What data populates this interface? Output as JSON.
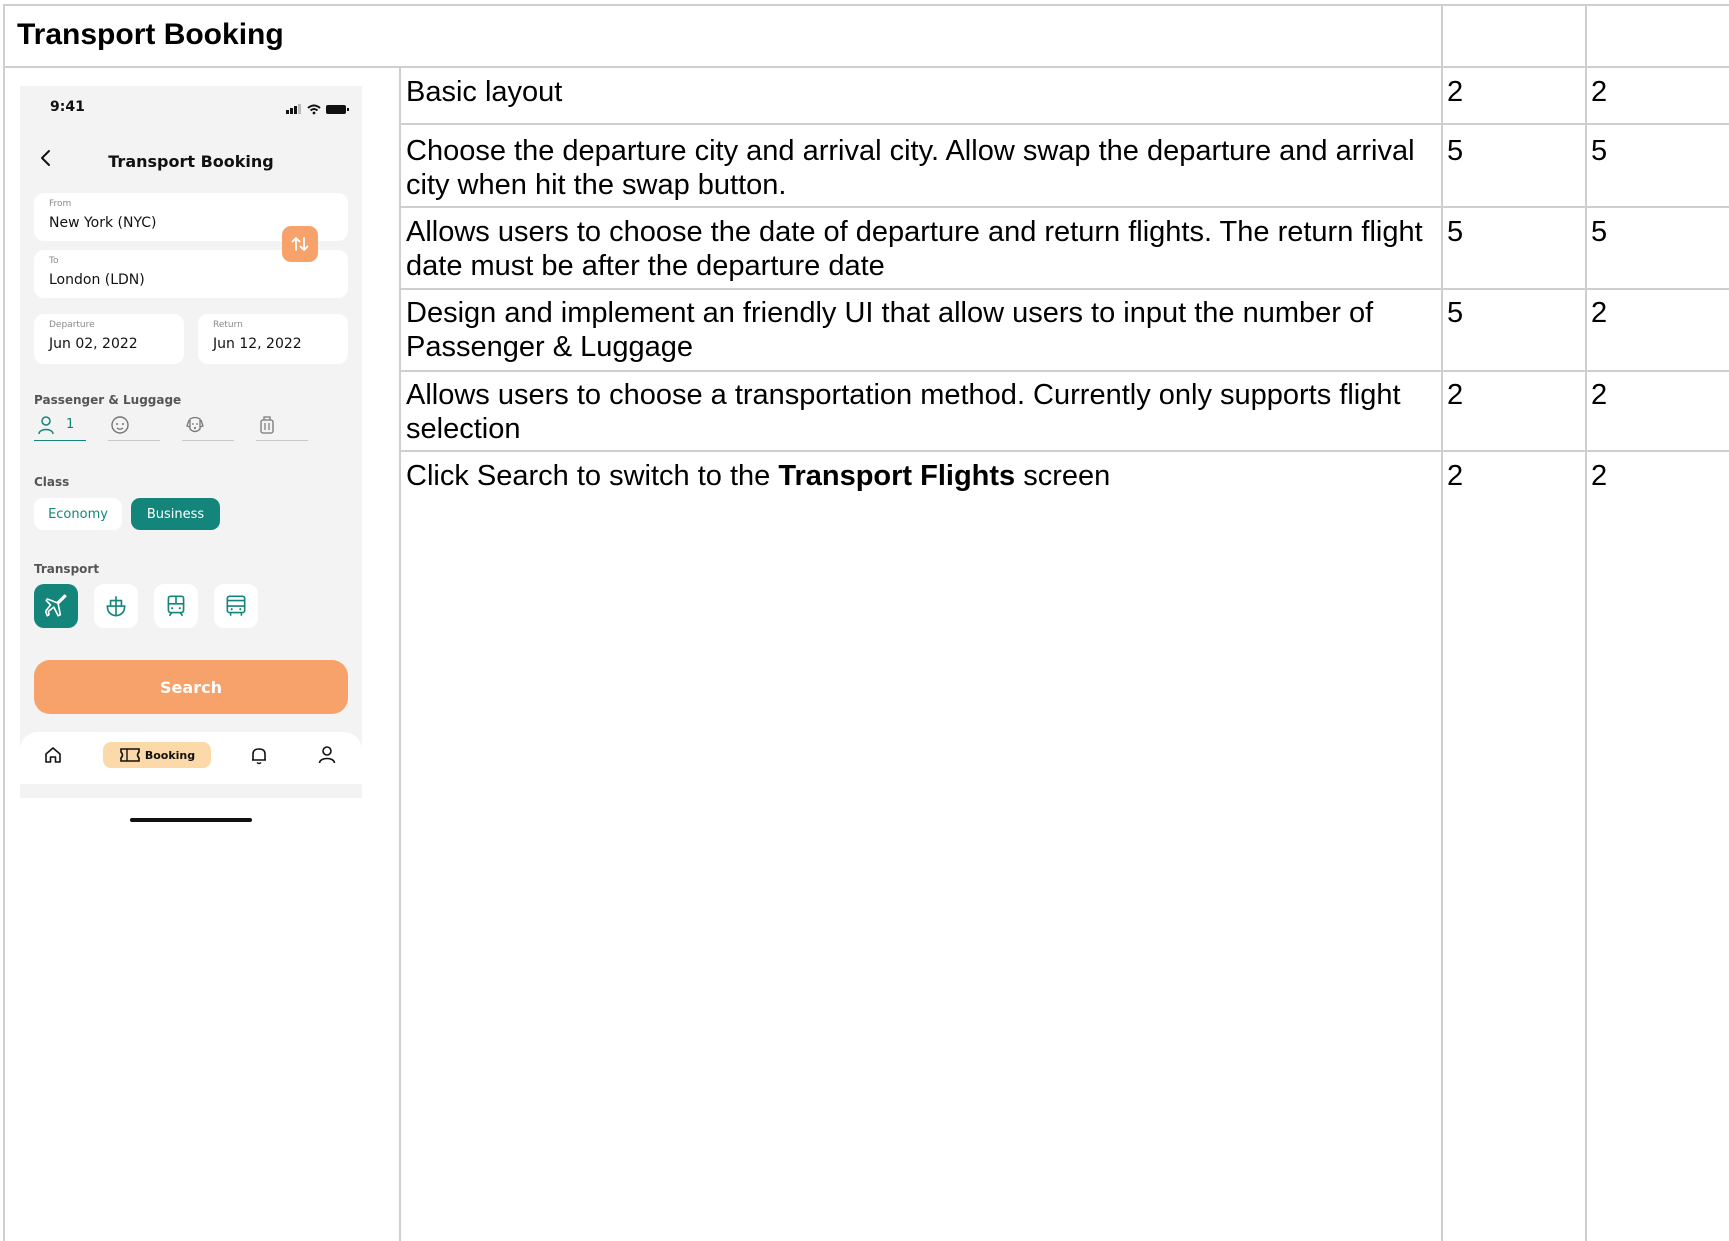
{
  "sheet": {
    "title": "Transport Booking",
    "rows": [
      {
        "requirement": "Basic layout",
        "score_a": "2",
        "score_b": "2"
      },
      {
        "requirement": "Choose the departure city and arrival city. Allow swap the departure and arrival city when hit the swap button.",
        "score_a": "5",
        "score_b": "5"
      },
      {
        "requirement": "Allows users to choose the date of departure and return flights. The return flight date must be after the departure date",
        "score_a": "5",
        "score_b": "5"
      },
      {
        "requirement": "Design and implement an friendly UI that allow users to input the number of Passenger & Luggage",
        "score_a": "5",
        "score_b": "2"
      },
      {
        "requirement": "Allows users to choose a transportation method. Currently only supports flight selection",
        "score_a": "2",
        "score_b": "2"
      },
      {
        "requirement_prefix": "Click Search to switch to the ",
        "requirement_bold": "Transport Flights",
        "requirement_suffix": " screen",
        "score_a": "2",
        "score_b": "2"
      }
    ]
  },
  "phone": {
    "status_time": "9:41",
    "title": "Transport Booking",
    "from": {
      "label": "From",
      "value": "New York (NYC)"
    },
    "to": {
      "label": "To",
      "value": "London (LDN)"
    },
    "departure": {
      "label": "Departure",
      "value": "Jun 02, 2022"
    },
    "return": {
      "label": "Return",
      "value": "Jun 12, 2022"
    },
    "passenger_label": "Passenger & Luggage",
    "adult_count": "1",
    "class_label": "Class",
    "class_options": [
      "Economy",
      "Business"
    ],
    "selected_class": "Business",
    "transport_label": "Transport",
    "transport_icons": [
      "plane-icon",
      "ship-icon",
      "train-icon",
      "bus-icon"
    ],
    "search_label": "Search",
    "tabs": {
      "booking_label": "Booking"
    }
  },
  "colors": {
    "teal": "#14857a",
    "orange": "#f7a26b",
    "booking_pill": "#fcd9a8",
    "grid": "#cfcfcf"
  }
}
